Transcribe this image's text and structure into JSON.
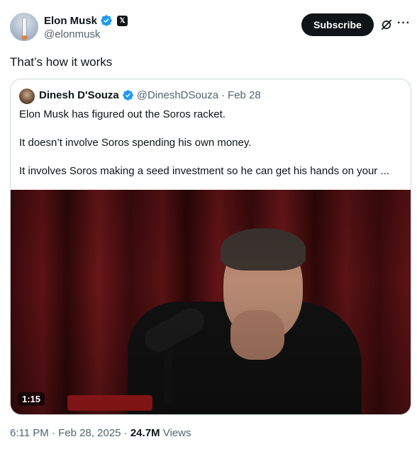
{
  "author": {
    "name": "Elon Musk",
    "handle": "@elonmusk",
    "subscribe_label": "Subscribe"
  },
  "tweet": {
    "text": "That’s how it works"
  },
  "quoted": {
    "name": "Dinesh D'Souza",
    "handle": "@DineshDSouza",
    "separator": "·",
    "date": "Feb 28",
    "lines": [
      "Elon Musk has figured out the Soros racket.",
      "It doesn’t involve Soros spending his own money.",
      "It involves Soros making a seed investment so he can get his hands on your ..."
    ],
    "video_duration": "1:15"
  },
  "footer": {
    "time": "6:11 PM",
    "separator": " · ",
    "date": "Feb 28, 2025",
    "views_count": "24.7M",
    "views_label": "Views"
  },
  "colors": {
    "verified": "#1d9bf0",
    "text_primary": "#0f1419",
    "text_secondary": "#536471",
    "border": "#cfd9de"
  },
  "icons": [
    "verified-badge-icon",
    "x-affiliate-icon",
    "grok-icon",
    "more-icon"
  ]
}
